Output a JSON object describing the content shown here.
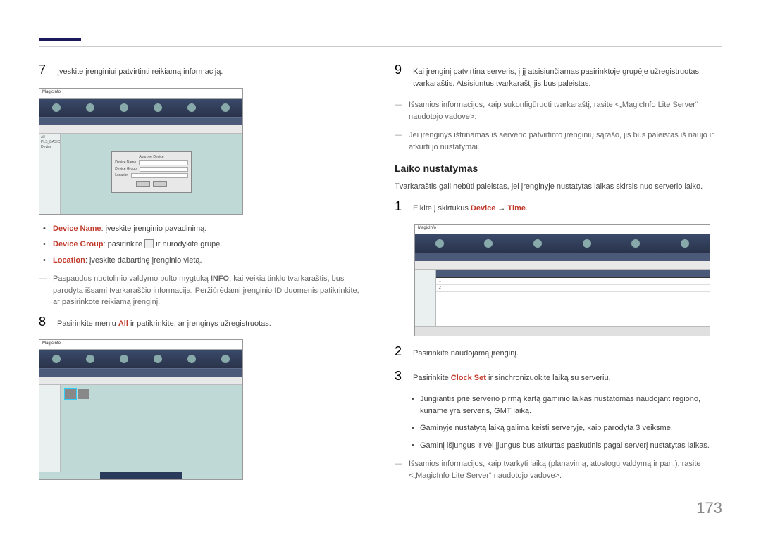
{
  "page_number": "173",
  "left": {
    "step7": "Įveskite įrenginiui patvirtinti reikiamą informaciją.",
    "bullets": {
      "device_name_label": "Device Name",
      "device_name_text": ": įveskite įrenginio pavadinimą.",
      "device_group_label": "Device Group",
      "device_group_text_a": ": pasirinkite ",
      "device_group_text_b": " ir nurodykite grupę.",
      "location_label": "Location",
      "location_text": ": įveskite dabartinę įrenginio vietą."
    },
    "dash1_a": "Paspaudus nuotolinio valdymo pulto mygtuką ",
    "dash1_bold": "INFO",
    "dash1_b": ", kai veikia tinklo tvarkaraštis, bus parodyta išsami tvarkaraščio informacija. Peržiūrėdami įrenginio ID duomenis patikrinkite, ar pasirinkote reikiamą įrenginį.",
    "step8_a": "Pasirinkite meniu ",
    "step8_bold": "All",
    "step8_b": " ir patikrinkite, ar įrenginys užregistruotas.",
    "ss_brand": "MagicInfo",
    "ss_side_items": [
      "All",
      "PLS_BASIC",
      "Device"
    ],
    "ss1_dialog_title": "Approve Device",
    "ss1_dialog_rows": [
      "Device Name",
      "Device Group",
      "Location"
    ]
  },
  "right": {
    "step9_a": "Kai įrenginį patvirtina serveris, į jį atsisiunčiamas pasirinktoje grupėje užregistruotas tvarkaraštis. Atsisiuntus tvarkaraštį jis bus paleistas.",
    "dash1": "Išsamios informacijos, kaip sukonfigūruoti tvarkaraštį, rasite <„MagicInfo Lite Server“ naudotojo vadove>.",
    "dash2": "Jei įrenginys ištrinamas iš serverio patvirtinto įrenginių sąrašo, jis bus paleistas iš naujo ir atkurti jo nustatymai.",
    "heading": "Laiko nustatymas",
    "intro": "Tvarkaraštis gali nebūti paleistas, jei įrenginyje nustatytas laikas skirsis nuo serverio laiko.",
    "step1_a": "Eikite į skirtukus ",
    "step1_bold1": "Device",
    "step1_arrow": " → ",
    "step1_bold2": "Time",
    "step1_end": ".",
    "step2": "Pasirinkite naudojamą įrenginį.",
    "step3_a": "Pasirinkite ",
    "step3_bold": "Clock Set",
    "step3_b": " ir sinchronizuokite laiką su serveriu.",
    "sub1": "Jungiantis prie serverio pirmą kartą gaminio laikas nustatomas naudojant regiono, kuriame yra serveris, GMT laiką.",
    "sub2": "Gaminyje nustatytą laiką galima keisti serveryje, kaip parodyta 3 veiksme.",
    "sub3": "Gaminį išjungus ir vėl įjungus bus atkurtas paskutinis pagal serverį nustatytas laikas.",
    "dash3": "Išsamios informacijos, kaip tvarkyti laiką (planavimą, atostogų valdymą ir pan.), rasite <„MagicInfo Lite Server“ naudotojo vadove>.",
    "ss_brand": "MagicInfo",
    "ss3_rows": [
      "1",
      "2"
    ]
  }
}
